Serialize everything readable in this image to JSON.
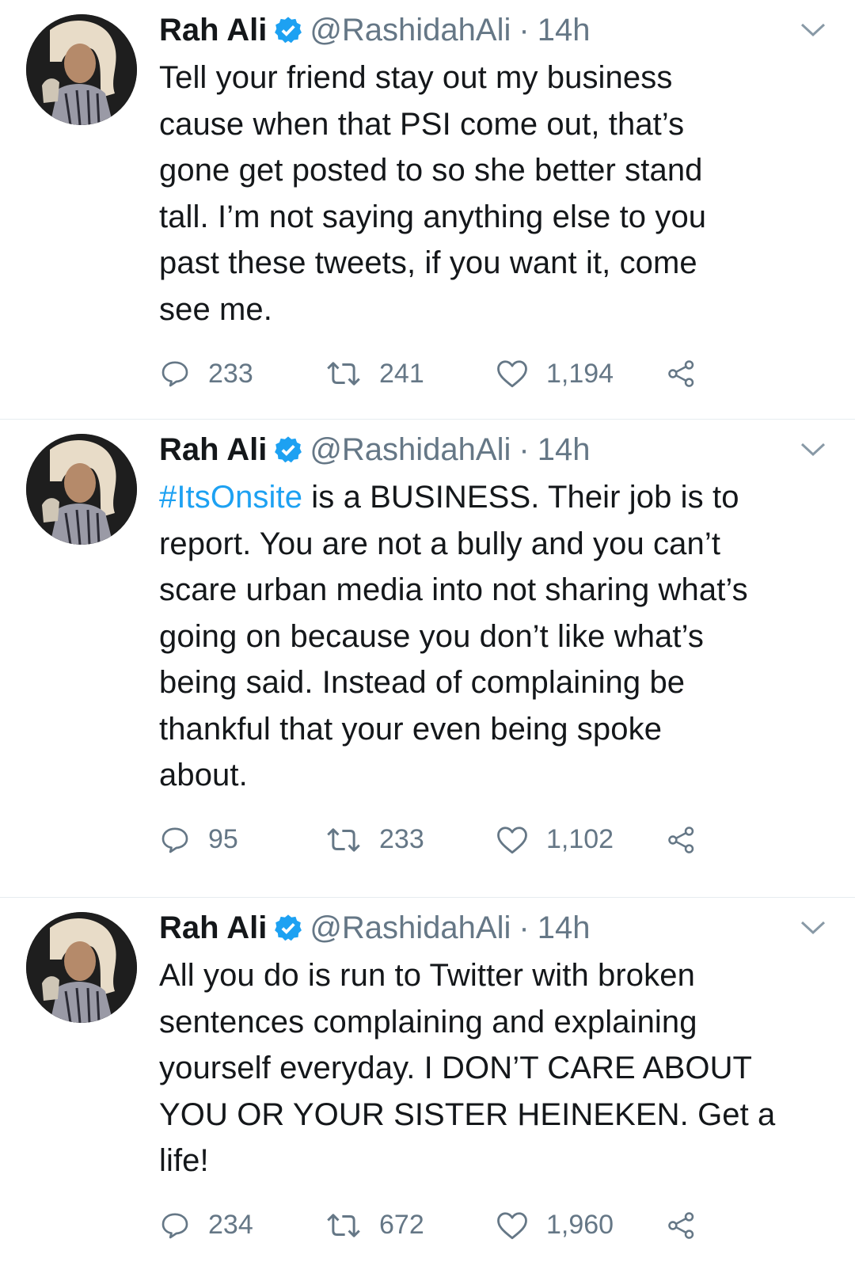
{
  "tweets": [
    {
      "name": "Rah Ali",
      "handle": "@RashidahAli",
      "separator": "·",
      "time": "14h",
      "hashtag": "",
      "text": "Tell your friend stay out my business\ncause when that PSI come out, that’s\ngone get posted to so she better stand\ntall. I’m not saying anything else to you\npast these tweets, if you want it, come\nsee me.",
      "replies": "233",
      "retweets": "241",
      "likes": "1,194"
    },
    {
      "name": "Rah Ali",
      "handle": "@RashidahAli",
      "separator": "·",
      "time": "14h",
      "hashtag": "#ItsOnsite",
      "text": " is a BUSINESS. Their job is to\nreport. You are not a bully and you can’t\nscare urban media into not sharing what’s\ngoing on because you don’t like what’s\nbeing said. Instead of complaining be\nthankful that your even being spoke\nabout.",
      "replies": "95",
      "retweets": "233",
      "likes": "1,102"
    },
    {
      "name": "Rah Ali",
      "handle": "@RashidahAli",
      "separator": "·",
      "time": "14h",
      "hashtag": "",
      "text": "All you do is run to Twitter with broken\nsentences complaining and explaining\nyourself everyday. I DON’T CARE ABOUT\nYOU OR YOUR SISTER HEINEKEN. Get a\nlife!",
      "replies": "234",
      "retweets": "672",
      "likes": "1,960"
    }
  ],
  "icons": {
    "verified": "verified-badge-icon",
    "caret": "chevron-down-icon",
    "reply": "reply-icon",
    "retweet": "retweet-icon",
    "like": "heart-icon",
    "share": "share-icon"
  },
  "colors": {
    "link": "#1da1f2",
    "muted": "#657786",
    "text": "#14171a"
  }
}
